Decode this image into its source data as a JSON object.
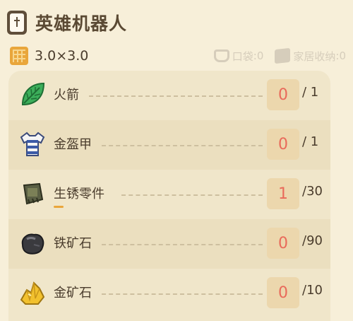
{
  "header": {
    "title": "英雄机器人",
    "icon": "recipe-card-icon"
  },
  "info": {
    "size": "3.0×3.0",
    "pocket_label": "口袋",
    "pocket_count": ":0",
    "storage_label": "家居收纳",
    "storage_count": ":0"
  },
  "materials": [
    {
      "name": "火箭",
      "icon": "leaf-icon",
      "owned": "0",
      "need": "/ 1"
    },
    {
      "name": "金盔甲",
      "icon": "striped-shirt-icon",
      "owned": "0",
      "need": "/ 1"
    },
    {
      "name": "生锈零件",
      "icon": "rusty-part-icon",
      "owned": "1",
      "need": "/30",
      "progress": 0.033
    },
    {
      "name": "铁矿石",
      "icon": "iron-ore-icon",
      "owned": "0",
      "need": "/90"
    },
    {
      "name": "金矿石",
      "icon": "gold-ore-icon",
      "owned": "0",
      "need": "/10"
    }
  ],
  "colors": {
    "background": "#f7efd9",
    "count_red": "#e96a5a",
    "accent": "#e9a63b"
  }
}
